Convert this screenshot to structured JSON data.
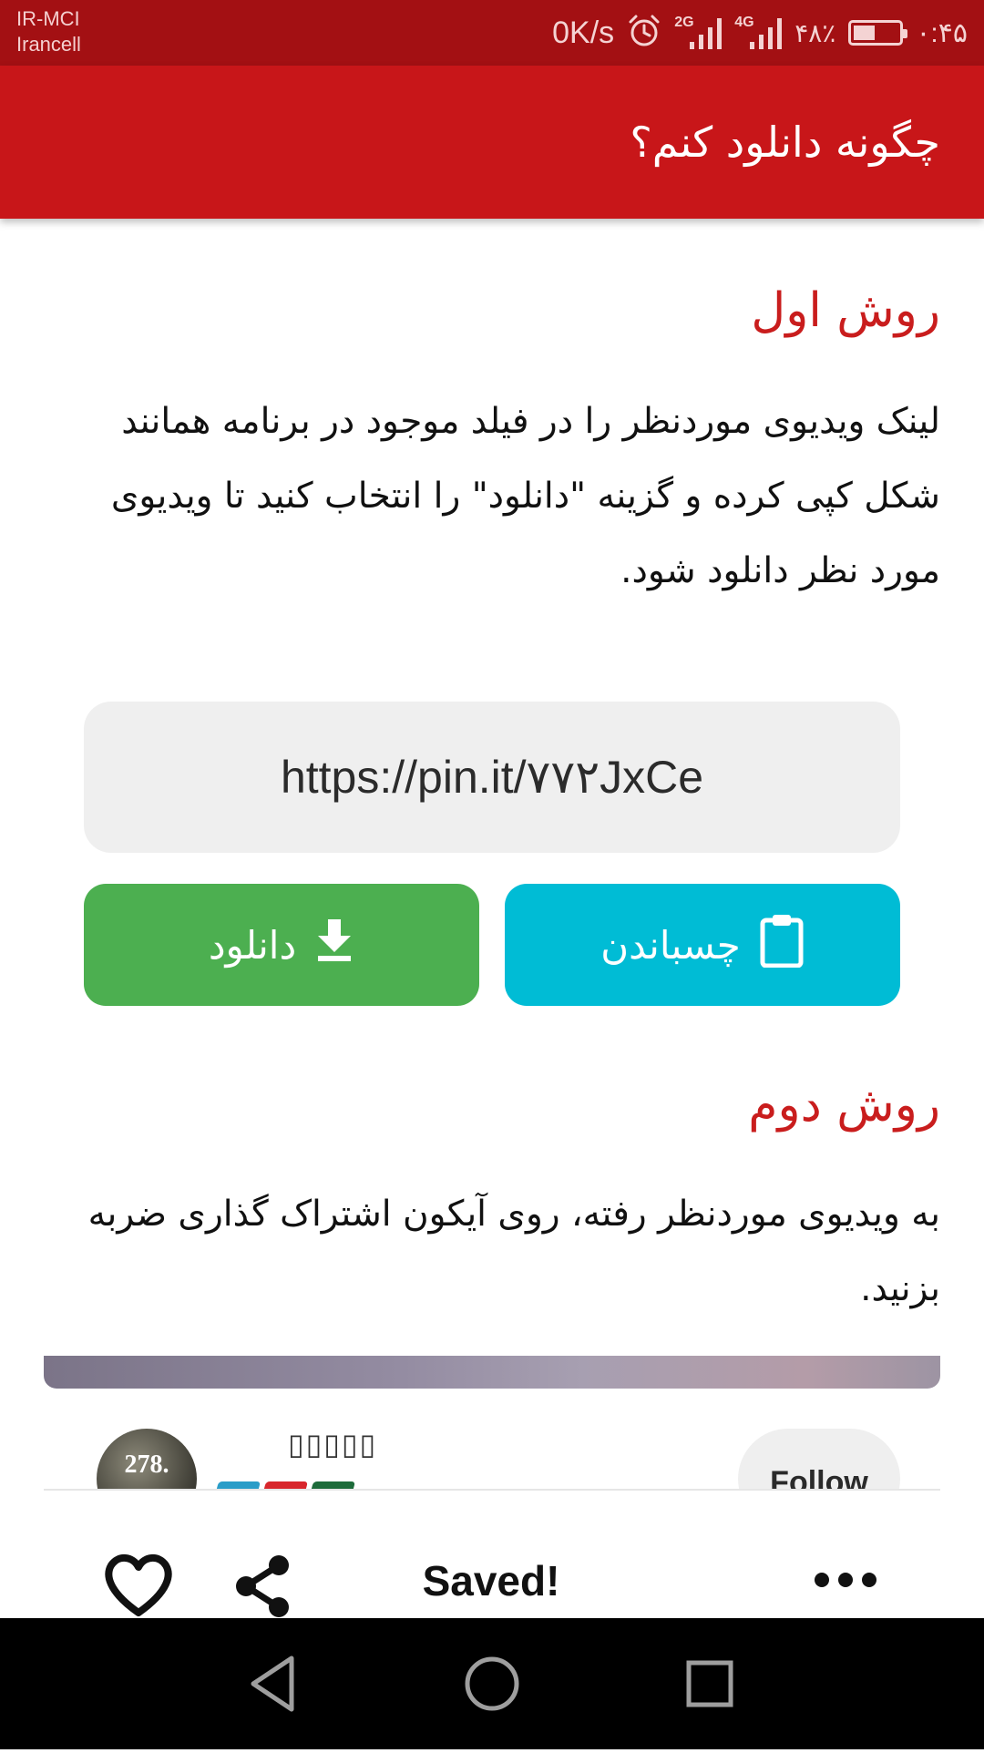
{
  "status_bar": {
    "carrier_line1": "IR-MCI",
    "carrier_line2": "Irancell",
    "net_speed": "0K/s",
    "signal1_tag": "2G",
    "signal2_tag": "4G",
    "battery_percent": "۴۸٪",
    "battery_level": 0.48,
    "time": "۰:۴۵"
  },
  "app_bar": {
    "title": "چگونه دانلود کنم؟"
  },
  "method1": {
    "title": "روش اول",
    "text": "لینک ویدیوی موردنظر را در فیلد موجود در برنامه همانند شکل کپی کرده و گزینه \"دانلود\" را انتخاب کنید تا ویدیوی مورد نظر دانلود شود."
  },
  "url_box": {
    "value": "https://pin.it/۷۷۲JxCe"
  },
  "buttons": {
    "paste_label": "چسباندن",
    "download_label": "دانلود"
  },
  "method2": {
    "title": "روش دوم",
    "text": "به ویدیوی موردنظر رفته، روی آیکون اشتراک گذاری ضربه بزنید."
  },
  "pin_card": {
    "avatar_text": "278.",
    "username": "▯▯▯▯▯",
    "follow_label": "Follow",
    "saved_label": "Saved!"
  },
  "colors": {
    "status_bar": "#a31013",
    "app_bar": "#c81619",
    "section_title": "#c91d1d",
    "paste_button": "#00bcd5",
    "download_button": "#4caf50"
  }
}
